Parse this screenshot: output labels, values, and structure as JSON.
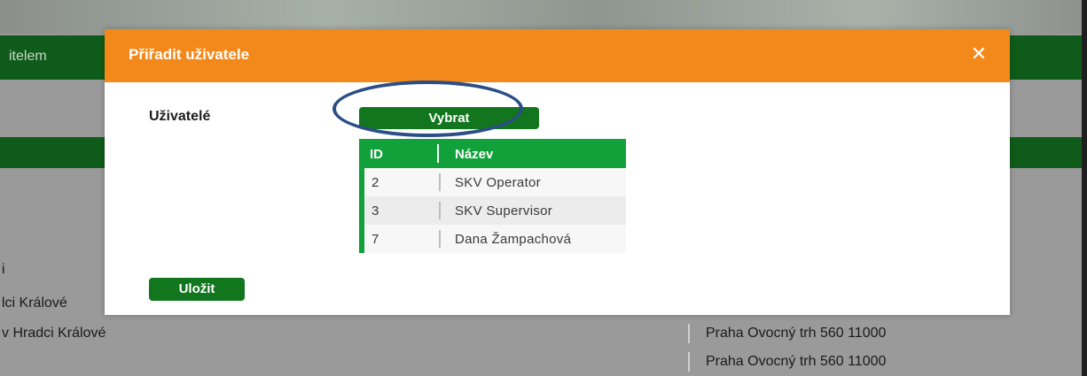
{
  "background": {
    "header_label": "itelem",
    "rows": [
      {
        "left": "i",
        "right": ""
      },
      {
        "left": "lci Králové",
        "right": ""
      },
      {
        "left": "v Hradci Králové",
        "right": "Praha Ovocný trh 560 11000"
      },
      {
        "left": "",
        "right": "Praha Ovocný trh 560 11000"
      }
    ]
  },
  "modal": {
    "title": "Přiřadit uživatele",
    "close_icon": "close-icon",
    "users_label": "Uživatelé",
    "select_button": "Vybrat",
    "save_button": "Uložit",
    "accent_color": "#f4891b",
    "button_color": "#11761d",
    "table": {
      "columns": [
        "ID",
        "Název"
      ],
      "rows": [
        {
          "id": "2",
          "name": "SKV Operator"
        },
        {
          "id": "3",
          "name": "SKV Supervisor"
        },
        {
          "id": "7",
          "name": "Dana Žampachová"
        }
      ]
    }
  }
}
